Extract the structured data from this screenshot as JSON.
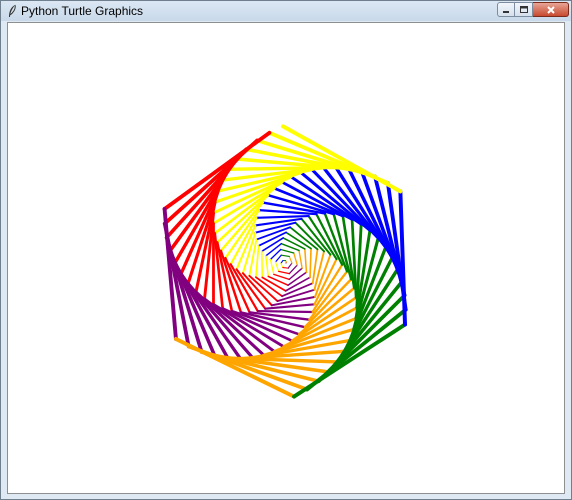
{
  "window": {
    "title": "Python Turtle Graphics",
    "icons": {
      "app": "feather-icon",
      "minimize": "minimize-icon",
      "maximize": "maximize-icon",
      "close": "close-icon"
    }
  },
  "drawing": {
    "shape": "hexagonal spiral",
    "colors": [
      "#ff0000",
      "#800080",
      "#ffa500",
      "#008000",
      "#0000ff",
      "#ffff00"
    ],
    "background": "#ffffff"
  }
}
